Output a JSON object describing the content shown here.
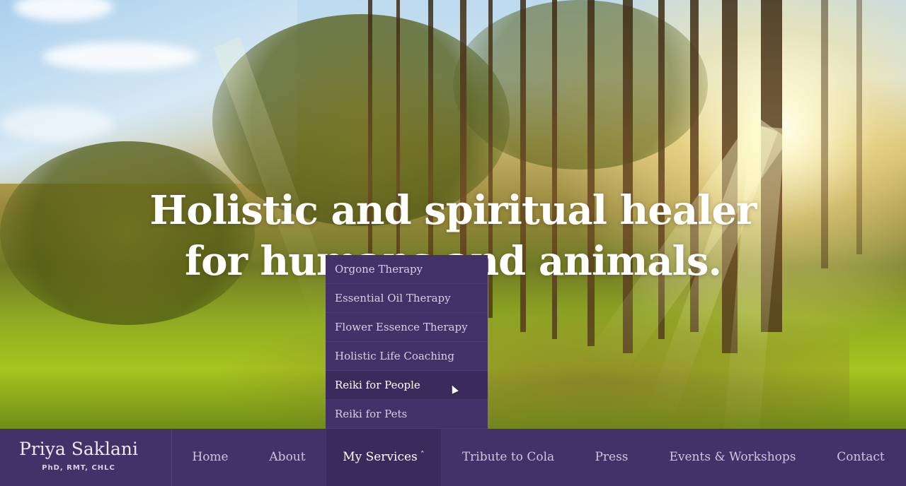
{
  "hero": {
    "title": "Holistic and spiritual healer for humans and animals."
  },
  "brand": {
    "name": "Priya Saklani",
    "credentials": "PhD, RMT, CHLC"
  },
  "nav": {
    "items": [
      {
        "label": "Home"
      },
      {
        "label": "About"
      },
      {
        "label": "My Services",
        "caret": "ˆ",
        "active": true
      },
      {
        "label": "Tribute to Cola"
      },
      {
        "label": "Press"
      },
      {
        "label": "Events & Workshops"
      },
      {
        "label": "Contact"
      }
    ]
  },
  "services_menu": {
    "items": [
      {
        "label": "Orgone Therapy"
      },
      {
        "label": "Essential Oil Therapy"
      },
      {
        "label": "Flower Essence Therapy"
      },
      {
        "label": "Holistic Life Coaching"
      },
      {
        "label": "Reiki for People",
        "hovered": true
      },
      {
        "label": "Reiki for Pets"
      }
    ]
  },
  "colors": {
    "nav_background": "#433268",
    "nav_active_background": "#3a2b5c",
    "hero_title": "#ffffff"
  }
}
